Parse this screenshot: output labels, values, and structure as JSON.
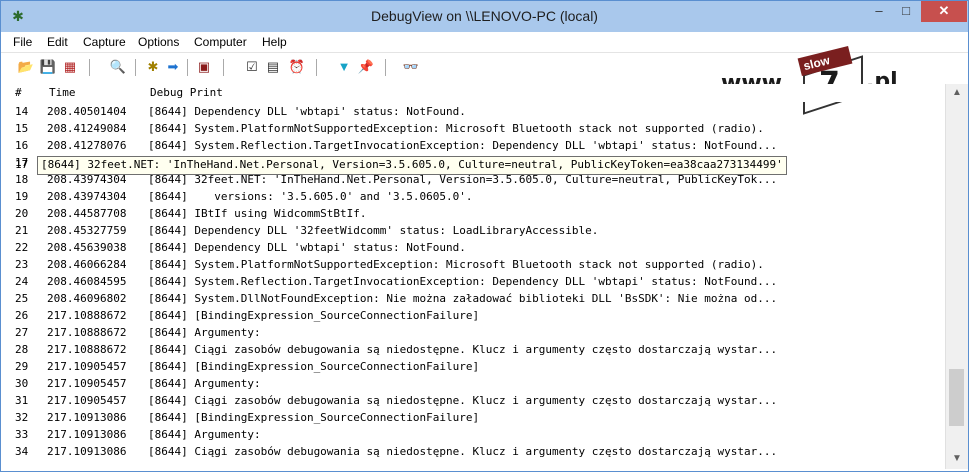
{
  "window": {
    "title": "DebugView on \\\\LENOVO-PC (local)",
    "app_icon": "debugview-icon",
    "controls": {
      "minimize": "–",
      "maximize": "□",
      "close": "✕"
    }
  },
  "menu": [
    "File",
    "Edit",
    "Capture",
    "Options",
    "Computer",
    "Help"
  ],
  "toolbar_icons": [
    "open-icon",
    "save-icon",
    "clear-icon",
    "find-icon",
    "capture-icon",
    "autoscroll-icon",
    "highlight-icon",
    "filter-icon",
    "history-icon",
    "clock-icon",
    "funnel-icon",
    "pin-icon",
    "binoculars-icon"
  ],
  "watermark": {
    "prefix": "www.",
    "badge": "slow",
    "mid": "7",
    "suffix": ".pl"
  },
  "columns": {
    "num": "#",
    "time": "Time",
    "debug": "Debug Print"
  },
  "rows": [
    {
      "num": "14",
      "time": "208.40501404",
      "msg": "[8644] Dependency DLL 'wbtapi' status: NotFound."
    },
    {
      "num": "15",
      "time": "208.41249084",
      "msg": "[8644] System.PlatformNotSupportedException: Microsoft Bluetooth stack not supported (radio)."
    },
    {
      "num": "16",
      "time": "208.41278076",
      "msg": "[8644] System.Reflection.TargetInvocationException: Dependency DLL 'wbtapi' status: NotFound..."
    },
    {
      "num": "17",
      "time": "",
      "msg": ""
    },
    {
      "num": "18",
      "time": "208.43974304",
      "msg": "[8644] 32feet.NET: 'InTheHand.Net.Personal, Version=3.5.605.0, Culture=neutral, PublicKeyTok..."
    },
    {
      "num": "19",
      "time": "208.43974304",
      "msg": "[8644]    versions: '3.5.605.0' and '3.5.0605.0'."
    },
    {
      "num": "20",
      "time": "208.44587708",
      "msg": "[8644] IBtIf using WidcommStBtIf."
    },
    {
      "num": "21",
      "time": "208.45327759",
      "msg": "[8644] Dependency DLL '32feetWidcomm' status: LoadLibraryAccessible."
    },
    {
      "num": "22",
      "time": "208.45639038",
      "msg": "[8644] Dependency DLL 'wbtapi' status: NotFound."
    },
    {
      "num": "23",
      "time": "208.46066284",
      "msg": "[8644] System.PlatformNotSupportedException: Microsoft Bluetooth stack not supported (radio)."
    },
    {
      "num": "24",
      "time": "208.46084595",
      "msg": "[8644] System.Reflection.TargetInvocationException: Dependency DLL 'wbtapi' status: NotFound..."
    },
    {
      "num": "25",
      "time": "208.46096802",
      "msg": "[8644] System.DllNotFoundException: Nie można załadować biblioteki DLL 'BsSDK': Nie można od..."
    },
    {
      "num": "26",
      "time": "217.10888672",
      "msg": "[8644] [BindingExpression_SourceConnectionFailure]"
    },
    {
      "num": "27",
      "time": "217.10888672",
      "msg": "[8644] Argumenty:"
    },
    {
      "num": "28",
      "time": "217.10888672",
      "msg": "[8644] Ciągi zasobów debugowania są niedostępne. Klucz i argumenty często dostarczają wystar..."
    },
    {
      "num": "29",
      "time": "217.10905457",
      "msg": "[8644] [BindingExpression_SourceConnectionFailure]"
    },
    {
      "num": "30",
      "time": "217.10905457",
      "msg": "[8644] Argumenty:"
    },
    {
      "num": "31",
      "time": "217.10905457",
      "msg": "[8644] Ciągi zasobów debugowania są niedostępne. Klucz i argumenty często dostarczają wystar..."
    },
    {
      "num": "32",
      "time": "217.10913086",
      "msg": "[8644] [BindingExpression_SourceConnectionFailure]"
    },
    {
      "num": "33",
      "time": "217.10913086",
      "msg": "[8644] Argumenty:"
    },
    {
      "num": "34",
      "time": "217.10913086",
      "msg": "[8644] Ciągi zasobów debugowania są niedostępne. Klucz i argumenty często dostarczają wystar..."
    }
  ],
  "tooltip": {
    "num": "17",
    "text": "[8644] 32feet.NET: 'InTheHand.Net.Personal, Version=3.5.605.0, Culture=neutral, PublicKeyToken=ea38caa273134499'"
  },
  "scroll": {
    "up": "▲",
    "down": "▼"
  }
}
